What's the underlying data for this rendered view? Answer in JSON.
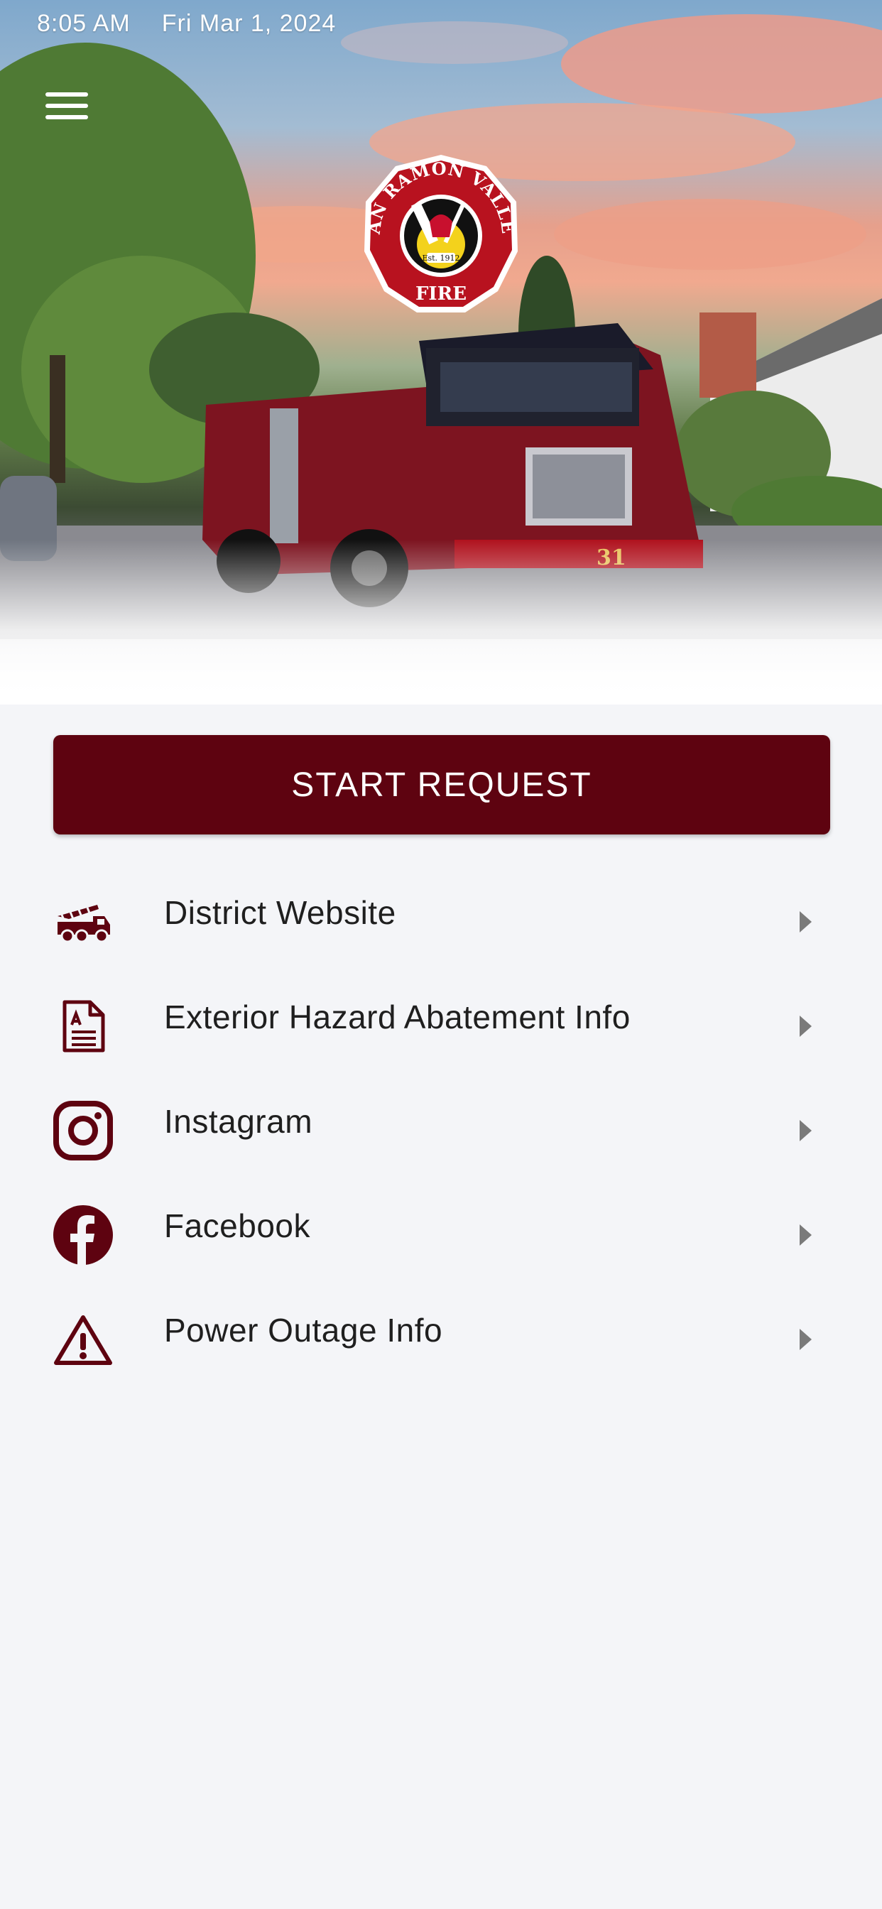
{
  "status_bar": {
    "time": "8:05 AM",
    "date": "Fri Mar 1, 2024"
  },
  "hero": {
    "logo_text": {
      "arc": "SAN RAMON VALLEY",
      "bottom": "FIRE",
      "established": "Est. 1912"
    },
    "truck_number": "31"
  },
  "start_button": {
    "label": "START REQUEST"
  },
  "menu_items": [
    {
      "label": "District Website",
      "icon": "fire-truck-icon"
    },
    {
      "label": "Exterior Hazard Abatement Info",
      "icon": "document-icon"
    },
    {
      "label": "Instagram",
      "icon": "instagram-icon"
    },
    {
      "label": "Facebook",
      "icon": "facebook-icon"
    },
    {
      "label": "Power Outage Info",
      "icon": "warning-icon"
    }
  ],
  "colors": {
    "brand": "#5e0310",
    "background": "#f4f5f8",
    "chevron": "#7a7a7a"
  }
}
